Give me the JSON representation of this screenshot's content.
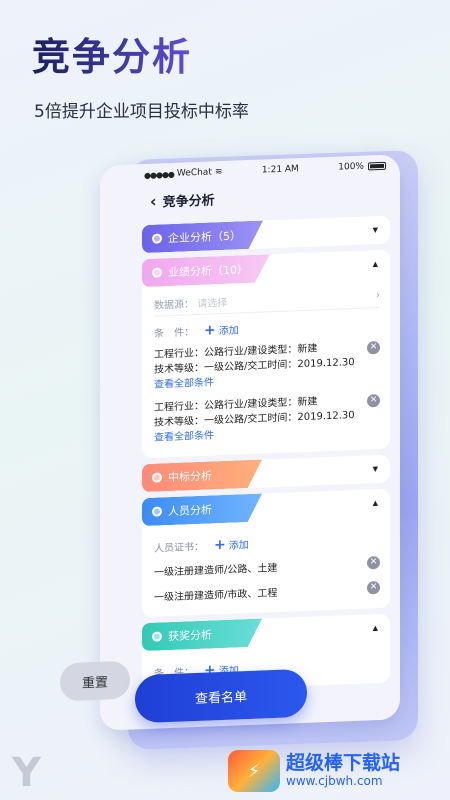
{
  "hero": {
    "title": "竞争分析",
    "subtitle": "5倍提升企业项目投标中标率"
  },
  "statusbar": {
    "signal_dots": "●●●●●",
    "carrier": "WeChat",
    "time": "1:21 AM",
    "battery": "100%"
  },
  "navbar": {
    "title": "竞争分析"
  },
  "sections": {
    "enterprise": {
      "label": "企业分析（5）",
      "color": "#6b63e8"
    },
    "performance": {
      "label": "业绩分析（10）",
      "color": "#f0a7ee",
      "datasource_label": "数据源：",
      "datasource_placeholder": "请选择",
      "condition_label": "条　件：",
      "add_label": "添加",
      "conditions": [
        {
          "line1": "工程行业：公路行业/建设类型：新建",
          "line2": "技术等级：一级公路/交工时间：2019.12.30",
          "link": "查看全部条件"
        },
        {
          "line1": "工程行业：公路行业/建设类型：新建",
          "line2": "技术等级：一级公路/交工时间：2019.12.30",
          "link": "查看全部条件"
        }
      ]
    },
    "bid": {
      "label": "中标分析",
      "color": "#ff8a7a"
    },
    "personnel": {
      "label": "人员分析",
      "color": "#3c8cf2",
      "cert_label": "人员证书：",
      "add_label": "添加",
      "certs": [
        "一级注册建造师/公路、土建",
        "一级注册建造师/市政、工程"
      ]
    },
    "awards": {
      "label": "获奖分析",
      "color": "#33c9b7",
      "condition_label": "条　件：",
      "add_label": "添加"
    }
  },
  "buttons": {
    "reset": "重置",
    "view_list": "查看名单"
  },
  "watermark": {
    "text": "超级棒下载站",
    "url": "www.cjbwh.com"
  }
}
